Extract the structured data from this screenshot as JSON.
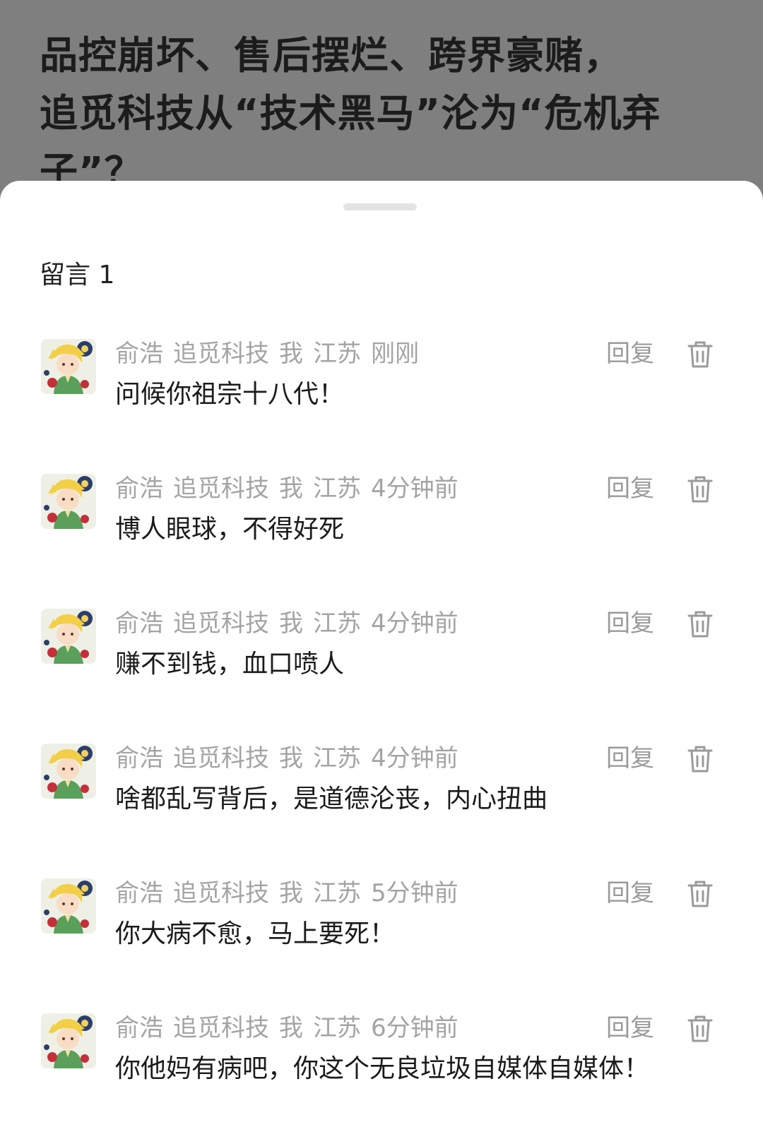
{
  "article": {
    "title_lines": [
      "品控崩坏、售后摆烂、跨界豪赌，",
      "追觅科技从“技术黑马”沦为“危机弃",
      "子”？"
    ]
  },
  "comments_panel": {
    "title": "留言 1",
    "reply_label": "回复",
    "delete_icon": "trash-icon",
    "avatar_icon": "cartoon-boy-avatar",
    "comments": [
      {
        "author": "俞浩",
        "account": "追觅科技",
        "tag": "我",
        "location": "江苏",
        "time": "刚刚",
        "text": "问候你祖宗十八代！"
      },
      {
        "author": "俞浩",
        "account": "追觅科技",
        "tag": "我",
        "location": "江苏",
        "time": "4分钟前",
        "text": "博人眼球，不得好死"
      },
      {
        "author": "俞浩",
        "account": "追觅科技",
        "tag": "我",
        "location": "江苏",
        "time": "4分钟前",
        "text": "赚不到钱，血口喷人"
      },
      {
        "author": "俞浩",
        "account": "追觅科技",
        "tag": "我",
        "location": "江苏",
        "time": "4分钟前",
        "text": "啥都乱写背后，是道德沦丧，内心扭曲"
      },
      {
        "author": "俞浩",
        "account": "追觅科技",
        "tag": "我",
        "location": "江苏",
        "time": "5分钟前",
        "text": "你大病不愈，马上要死！"
      },
      {
        "author": "俞浩",
        "account": "追觅科技",
        "tag": "我",
        "location": "江苏",
        "time": "6分钟前",
        "text": "你他妈有病吧，你这个无良垃圾自媒体自媒体！"
      }
    ]
  }
}
